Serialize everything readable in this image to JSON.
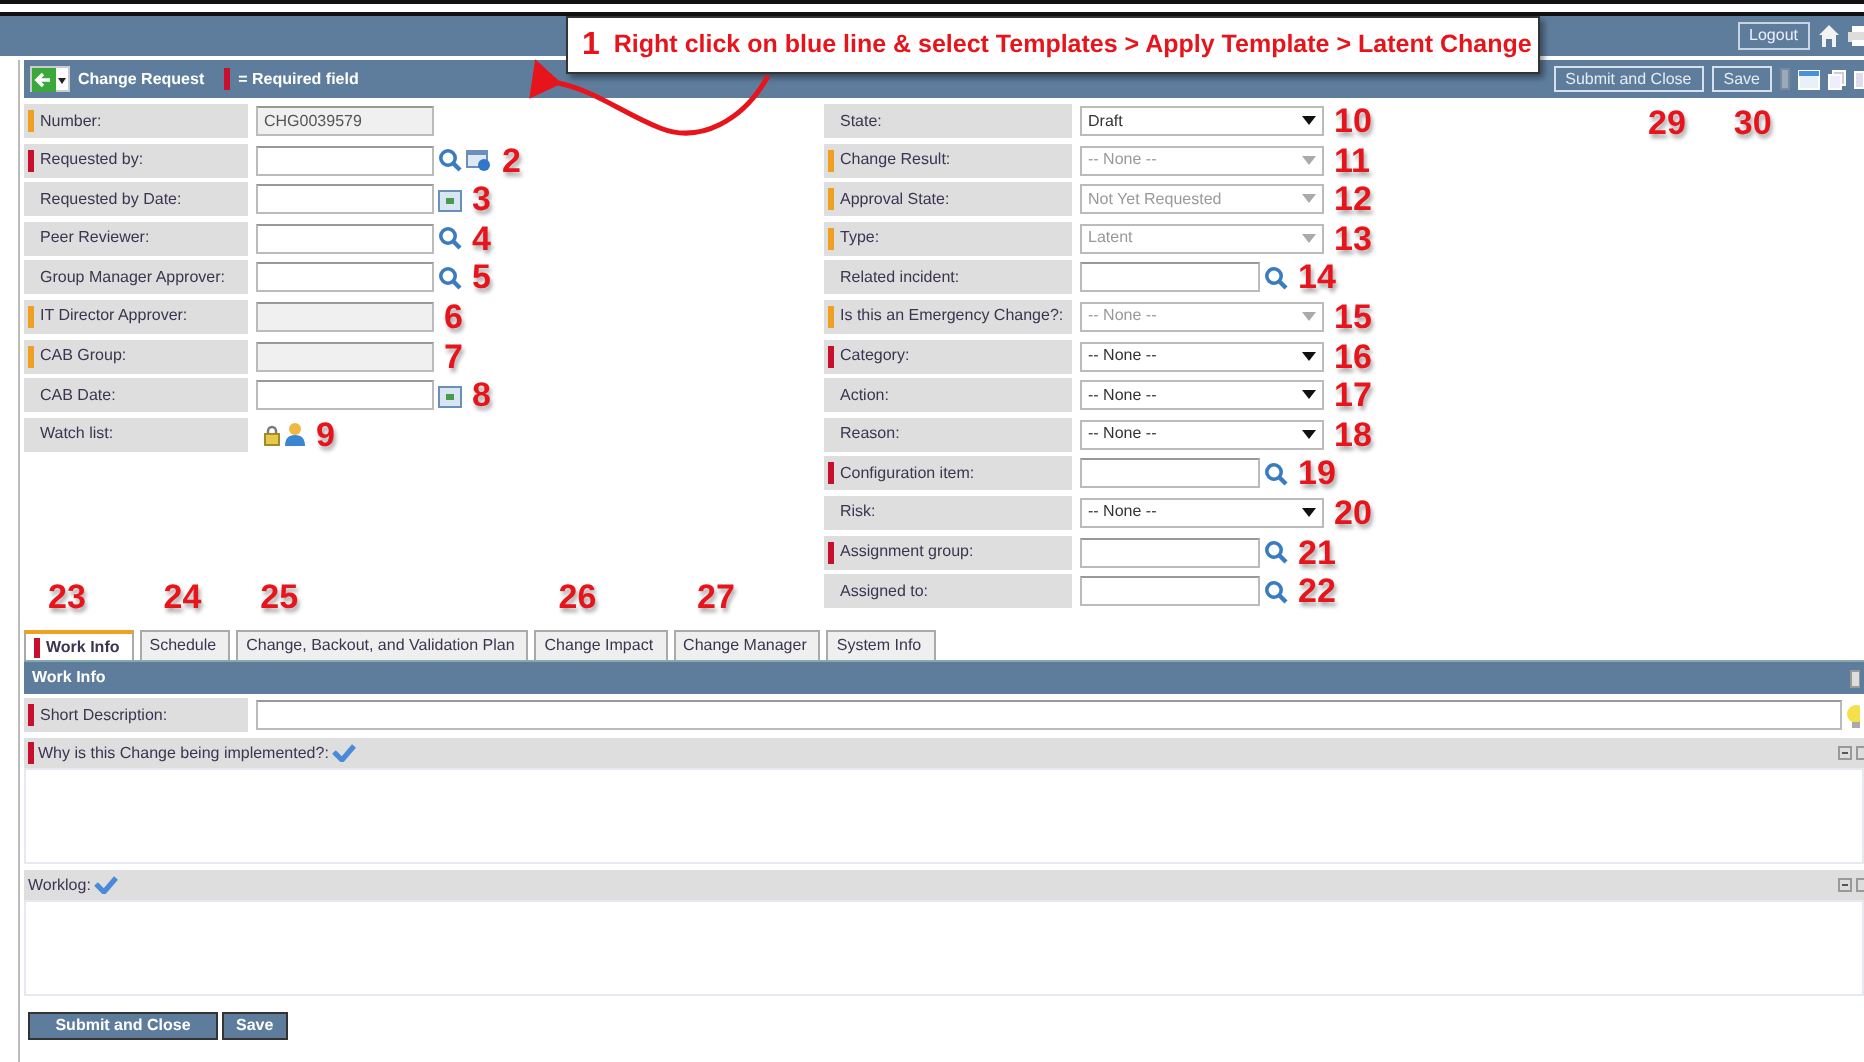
{
  "top_bar": {
    "logout": "Logout"
  },
  "form_header": {
    "title": "Change Request",
    "required_legend": "= Required field",
    "buttons": [
      {
        "label": "Submit and Close",
        "annotation": "29"
      },
      {
        "label": "Save",
        "annotation": "30"
      }
    ]
  },
  "callout": {
    "number": "1",
    "text": "Right click on blue line & select Templates > Apply Template > Latent Change"
  },
  "left_fields": [
    {
      "label": "Number:",
      "color": "#f0a020",
      "kind": "readonly",
      "value": "CHG0039579"
    },
    {
      "label": "Requested by:",
      "color": "#c8102e",
      "kind": "text",
      "icons": [
        {
          "kind": "lookup"
        },
        {
          "kind": "reference"
        }
      ],
      "annotation": "2"
    },
    {
      "label": "Requested by Date:",
      "kind": "text",
      "icons": [
        {
          "kind": "calendar"
        }
      ],
      "annotation": "3"
    },
    {
      "label": "Peer Reviewer:",
      "kind": "text",
      "icons": [
        {
          "kind": "lookup"
        }
      ],
      "annotation": "4"
    },
    {
      "label": "Group Manager Approver:",
      "kind": "text",
      "icons": [
        {
          "kind": "lookup"
        }
      ],
      "annotation": "5"
    },
    {
      "label": "IT Director Approver:",
      "color": "#f0a020",
      "kind": "readonly",
      "annotation": "6"
    },
    {
      "label": "CAB Group:",
      "color": "#f0a020",
      "kind": "readonly",
      "annotation": "7"
    },
    {
      "label": "CAB Date:",
      "kind": "text",
      "icons": [
        {
          "kind": "calendar"
        }
      ],
      "annotation": "8"
    },
    {
      "label": "Watch list:",
      "kind": "icons",
      "icons": [
        {
          "kind": "lock"
        },
        {
          "kind": "person"
        }
      ],
      "annotation": "9"
    }
  ],
  "right_fields": [
    {
      "label": "State:",
      "kind": "select",
      "value": "Draft",
      "disabled": false,
      "annotation": "10"
    },
    {
      "label": "Change Result:",
      "color": "#f0a020",
      "kind": "select",
      "value": "-- None --",
      "disabled": true,
      "annotation": "11"
    },
    {
      "label": "Approval State:",
      "color": "#f0a020",
      "kind": "select",
      "value": "Not Yet Requested",
      "disabled": true,
      "annotation": "12"
    },
    {
      "label": "Type:",
      "color": "#f0a020",
      "kind": "select",
      "value": "Latent",
      "disabled": true,
      "annotation": "13"
    },
    {
      "label": "Related incident:",
      "kind": "text",
      "icons": [
        {
          "kind": "lookup"
        }
      ],
      "annotation": "14"
    },
    {
      "label": "Is this an Emergency Change?:",
      "color": "#f0a020",
      "kind": "select",
      "value": "-- None --",
      "disabled": true,
      "annotation": "15"
    },
    {
      "label": "Category:",
      "color": "#c8102e",
      "kind": "select",
      "value": "-- None --",
      "disabled": false,
      "annotation": "16"
    },
    {
      "label": "Action:",
      "kind": "select",
      "value": "-- None --",
      "disabled": false,
      "annotation": "17"
    },
    {
      "label": "Reason:",
      "kind": "select",
      "value": "-- None --",
      "disabled": false,
      "annotation": "18"
    },
    {
      "label": "Configuration item:",
      "color": "#c8102e",
      "kind": "text",
      "icons": [
        {
          "kind": "lookup"
        }
      ],
      "annotation": "19"
    },
    {
      "label": "Risk:",
      "kind": "select",
      "value": "-- None --",
      "disabled": false,
      "annotation": "20"
    },
    {
      "label": "Assignment group:",
      "color": "#c8102e",
      "kind": "text",
      "icons": [
        {
          "kind": "lookup"
        }
      ],
      "annotation": "21"
    },
    {
      "label": "Assigned to:",
      "kind": "text",
      "icons": [
        {
          "kind": "lookup"
        }
      ],
      "annotation": "22"
    }
  ],
  "tabs": [
    {
      "label": "Work Info",
      "selected": true,
      "color": "#c8102e",
      "annotation": "23"
    },
    {
      "label": "Schedule",
      "selected": false,
      "annotation": "24"
    },
    {
      "label": "Change, Backout, and Validation Plan",
      "selected": false,
      "annotation": "25"
    },
    {
      "label": "Change Impact",
      "selected": false,
      "annotation": "26"
    },
    {
      "label": "Change Manager",
      "selected": false,
      "annotation": "27"
    },
    {
      "label": "System Info",
      "selected": false
    }
  ],
  "section": {
    "title": "Work Info",
    "fields": [
      {
        "label": "Short Description:",
        "color": "#c8102e",
        "kind": "line"
      },
      {
        "label": "Why is this Change being implemented?:",
        "color": "#c8102e",
        "kind": "journal"
      },
      {
        "label": "Worklog:",
        "kind": "journal"
      }
    ]
  },
  "bottom_buttons": [
    "Submit and Close",
    "Save"
  ]
}
